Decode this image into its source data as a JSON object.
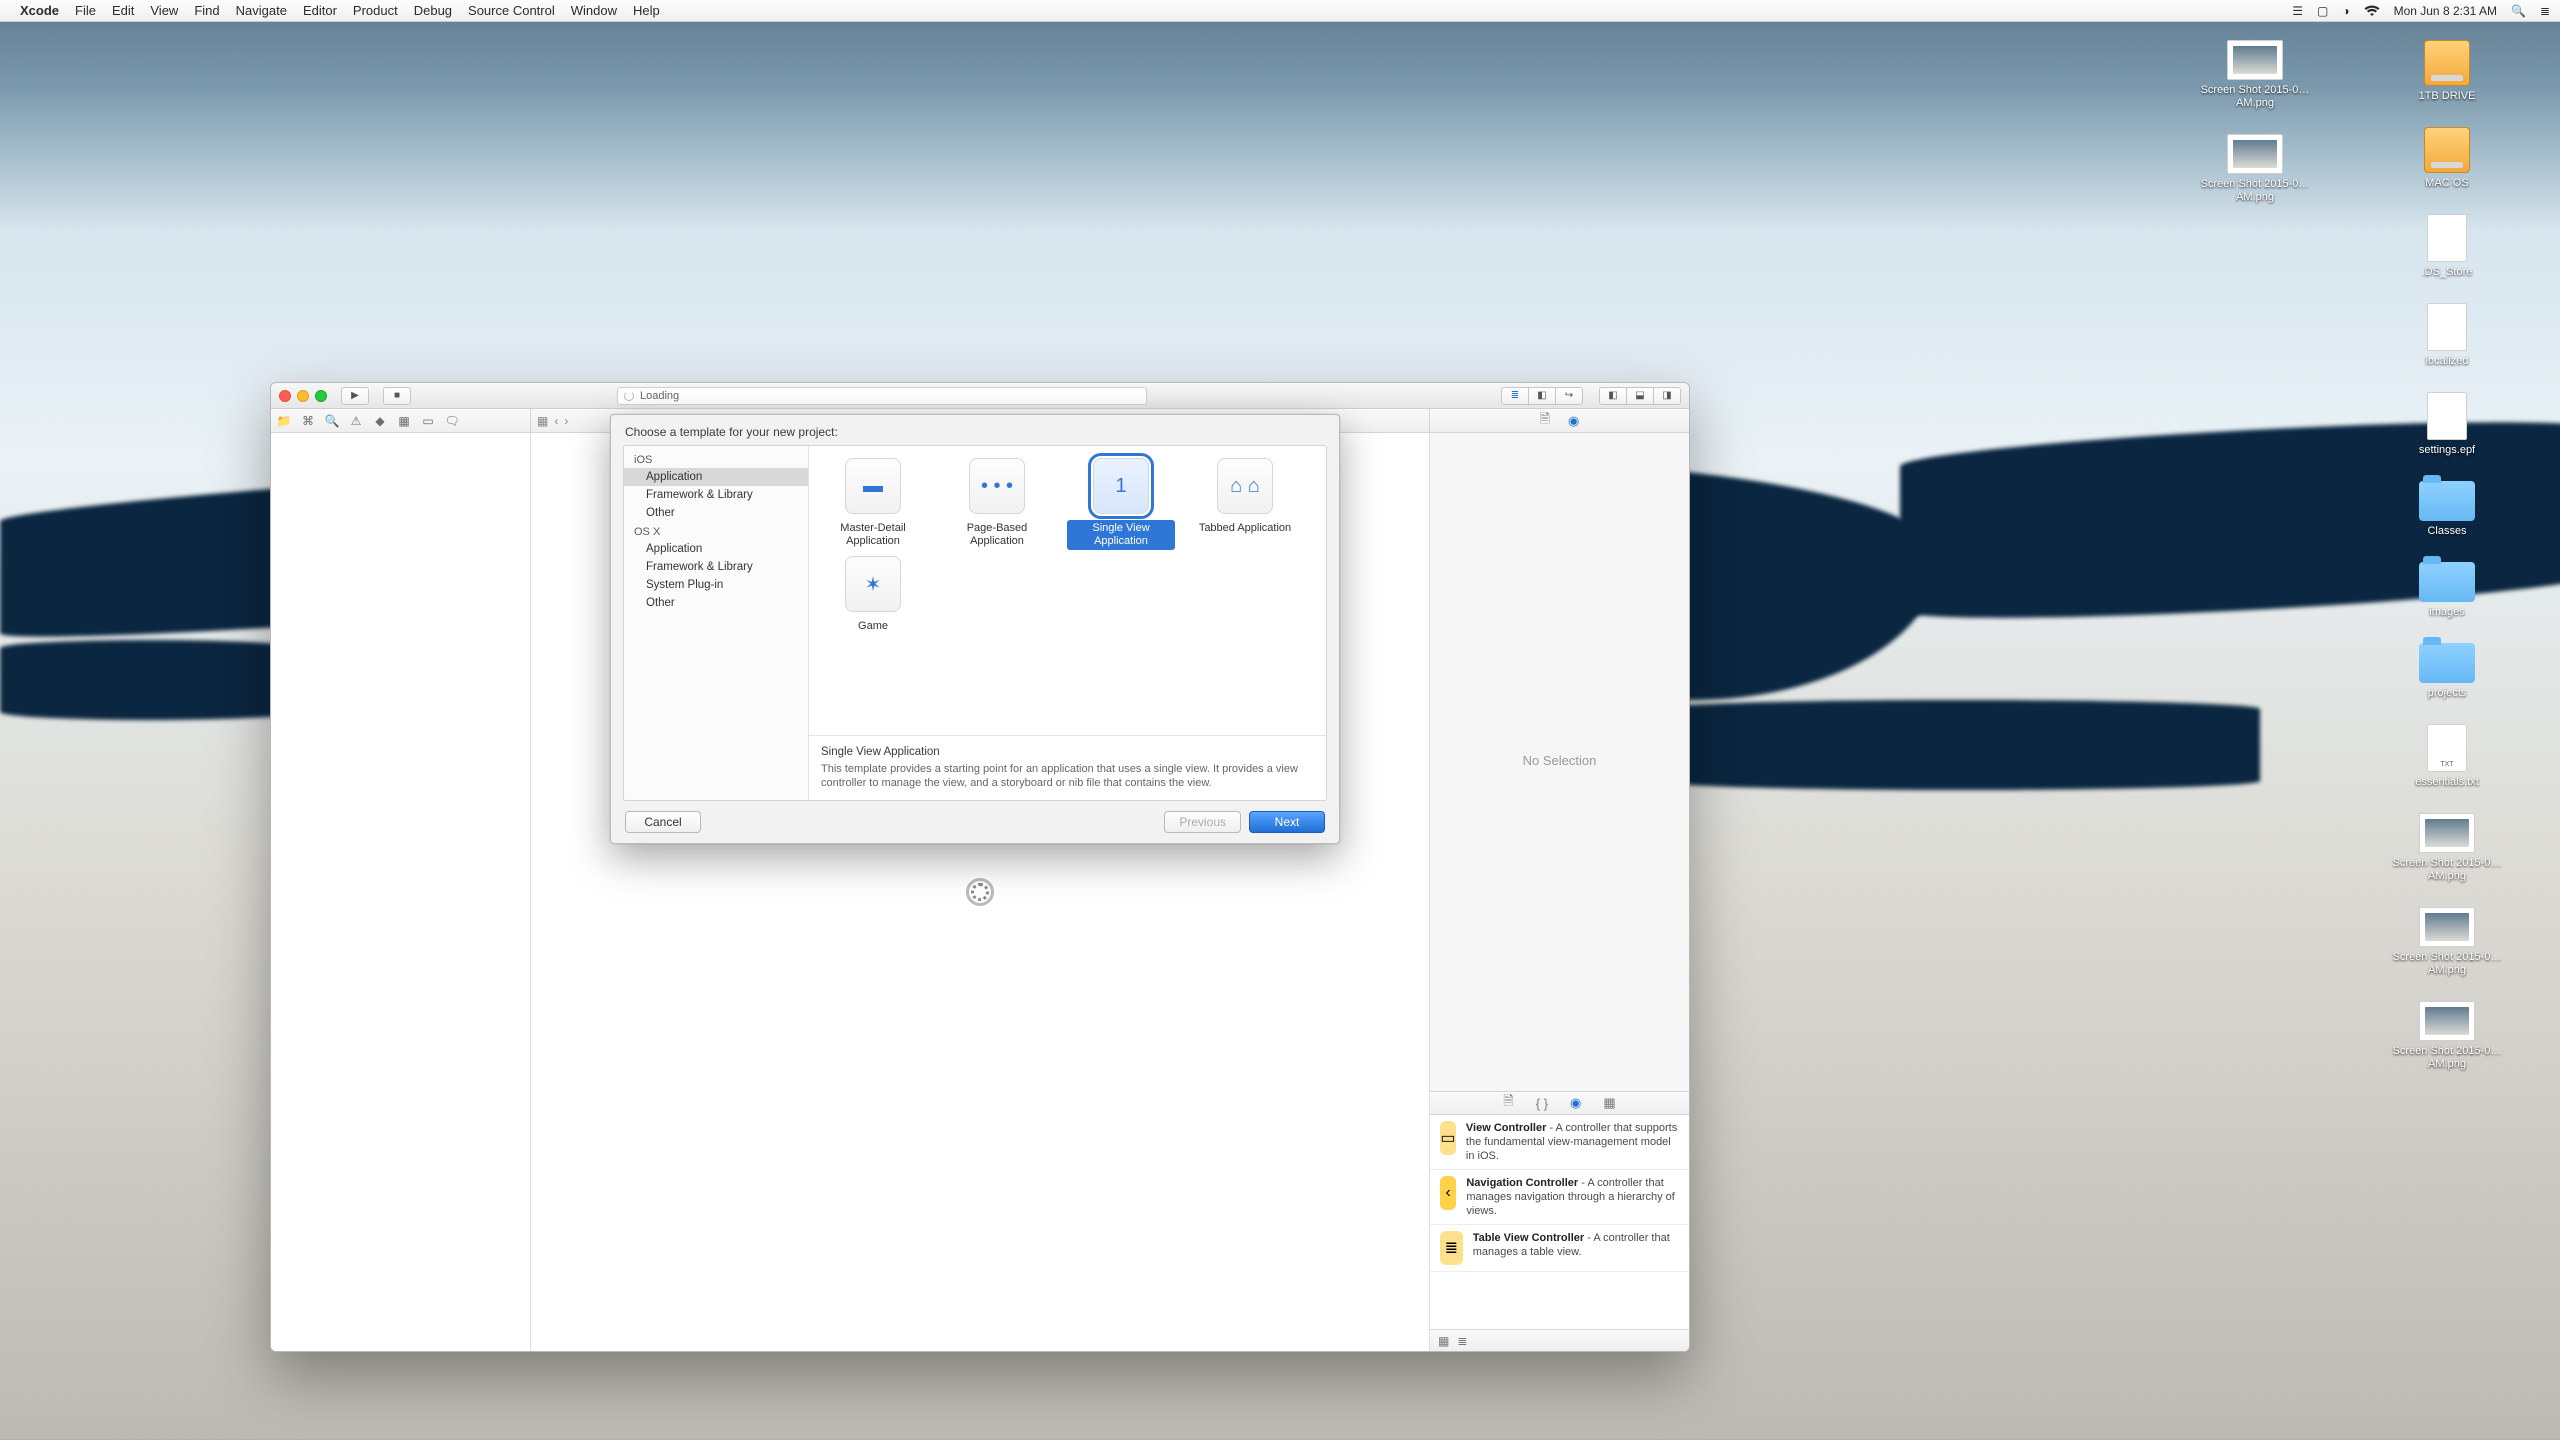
{
  "menubar": {
    "app": "Xcode",
    "items": [
      "File",
      "Edit",
      "View",
      "Find",
      "Navigate",
      "Editor",
      "Product",
      "Debug",
      "Source Control",
      "Window",
      "Help"
    ],
    "clock": "Mon Jun 8  2:31 AM"
  },
  "desktop_right": [
    {
      "kind": "drive",
      "label": "1TB DRIVE"
    },
    {
      "kind": "drive",
      "label": "MAC OS"
    },
    {
      "kind": "file",
      "label": ".DS_Store"
    },
    {
      "kind": "file",
      "label": "localized"
    },
    {
      "kind": "file",
      "label": "settings.epf"
    },
    {
      "kind": "folder",
      "label": "Classes"
    },
    {
      "kind": "folder",
      "label": "images"
    },
    {
      "kind": "folder",
      "label": "projects"
    },
    {
      "kind": "file",
      "label": "essentials.txt",
      "sub": "TXT"
    },
    {
      "kind": "thumb",
      "label": "Screen Shot 2015-0…AM.png"
    },
    {
      "kind": "thumb",
      "label": "Screen Shot 2015-0…AM.png"
    },
    {
      "kind": "thumb",
      "label": "Screen Shot 2015-0…AM.png"
    }
  ],
  "desktop_right2": [
    {
      "kind": "thumb",
      "label": "Screen Shot 2015-0…AM.png"
    },
    {
      "kind": "thumb",
      "label": "Screen Shot 2015-0…AM.png"
    }
  ],
  "xcode": {
    "activity": "Loading",
    "inspector_empty": "No Selection",
    "library": [
      {
        "title": "View Controller",
        "desc": "A controller that supports the fundamental view-management model in iOS.",
        "color": "#ffe08a",
        "glyph": "▭"
      },
      {
        "title": "Navigation Controller",
        "desc": "A controller that manages navigation through a hierarchy of views.",
        "color": "#ffd24a",
        "glyph": "‹"
      },
      {
        "title": "Table View Controller",
        "desc": "A controller that manages a table view.",
        "color": "#ffe08a",
        "glyph": "≣"
      }
    ]
  },
  "sheet": {
    "title": "Choose a template for your new project:",
    "sections": [
      {
        "header": "iOS",
        "items": [
          "Application",
          "Framework & Library",
          "Other"
        ],
        "selected": 0
      },
      {
        "header": "OS X",
        "items": [
          "Application",
          "Framework & Library",
          "System Plug-in",
          "Other"
        ]
      }
    ],
    "templates": [
      {
        "name": "Master-Detail Application",
        "glyph": "▬"
      },
      {
        "name": "Page-Based Application",
        "glyph": "• • •"
      },
      {
        "name": "Single View Application",
        "glyph": "1",
        "selected": true
      },
      {
        "name": "Tabbed Application",
        "glyph": "⌂ ⌂"
      },
      {
        "name": "Game",
        "glyph": "✶"
      }
    ],
    "detail": {
      "title": "Single View Application",
      "desc": "This template provides a starting point for an application that uses a single view. It provides a view controller to manage the view, and a storyboard or nib file that contains the view."
    },
    "buttons": {
      "cancel": "Cancel",
      "previous": "Previous",
      "next": "Next"
    }
  }
}
